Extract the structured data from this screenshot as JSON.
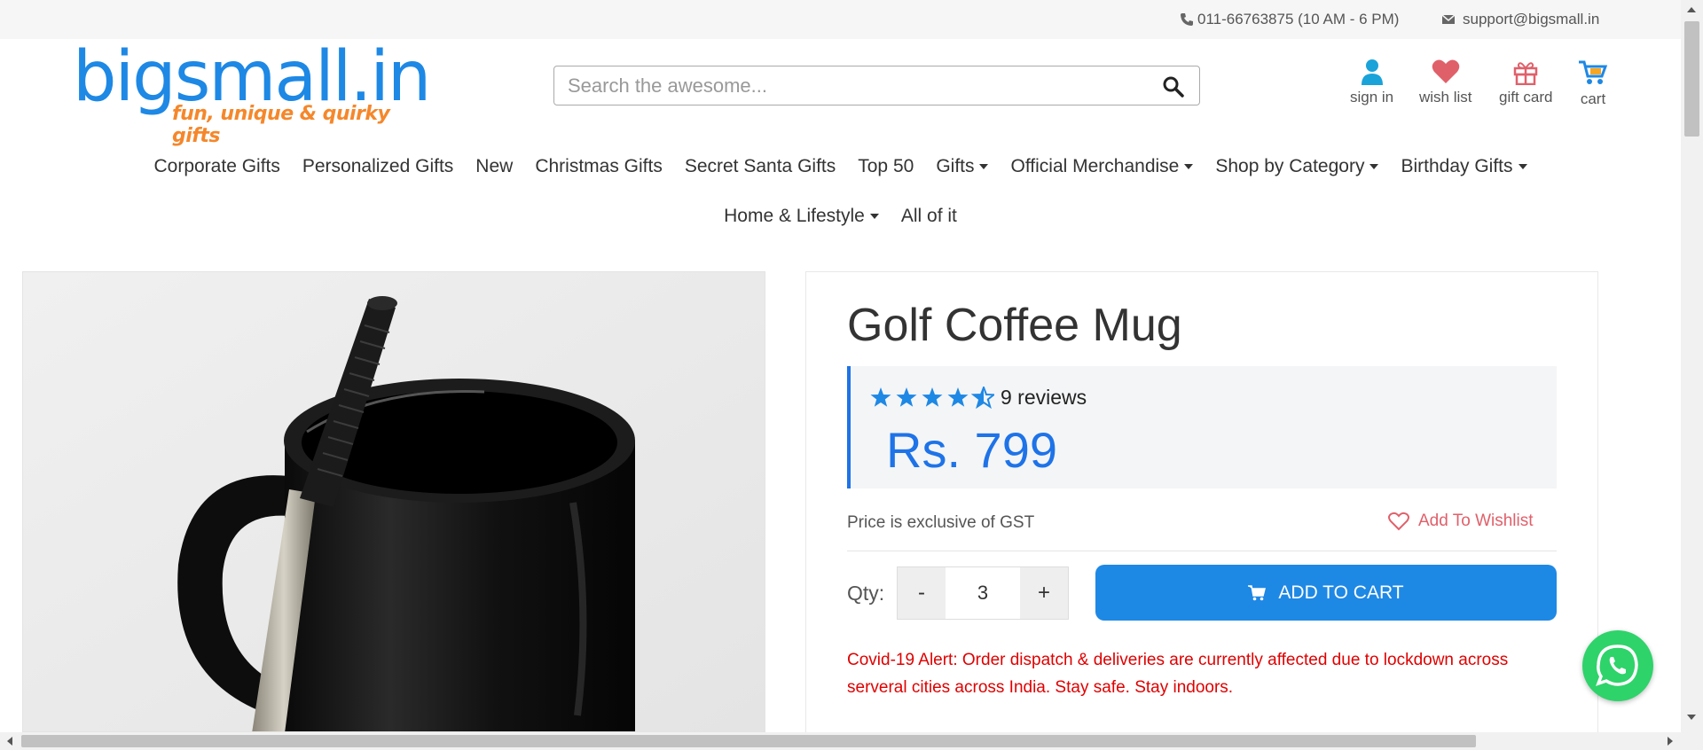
{
  "topbar": {
    "phone": "011-66763875 (10 AM - 6 PM)",
    "email": "support@bigsmall.in"
  },
  "logo": {
    "name": "bigsmall.in",
    "tagline": "fun, unique & quirky gifts"
  },
  "search": {
    "placeholder": "Search the awesome..."
  },
  "header_links": [
    {
      "label": "sign in",
      "icon": "user-icon",
      "color": "#1aa3d9"
    },
    {
      "label": "wish list",
      "icon": "heart-icon",
      "color": "#e0606a"
    },
    {
      "label": "gift card",
      "icon": "gift-icon",
      "color": "#e0606a"
    },
    {
      "label": "cart",
      "icon": "cart-icon",
      "color": "#1e88e5"
    }
  ],
  "nav": {
    "row1": [
      {
        "label": "Corporate Gifts",
        "dropdown": false
      },
      {
        "label": "Personalized Gifts",
        "dropdown": false
      },
      {
        "label": "New",
        "dropdown": false
      },
      {
        "label": "Christmas Gifts",
        "dropdown": false
      },
      {
        "label": "Secret Santa Gifts",
        "dropdown": false
      },
      {
        "label": "Top 50",
        "dropdown": false
      },
      {
        "label": "Gifts",
        "dropdown": true
      },
      {
        "label": "Official Merchandise",
        "dropdown": true
      },
      {
        "label": "Shop by Category",
        "dropdown": true
      },
      {
        "label": "Birthday Gifts",
        "dropdown": true
      }
    ],
    "row2": [
      {
        "label": "Home & Lifestyle",
        "dropdown": true
      },
      {
        "label": "All of it",
        "dropdown": false
      }
    ]
  },
  "product": {
    "title": "Golf Coffee Mug",
    "rating": 4.5,
    "reviews": "9 reviews",
    "price": "Rs. 799",
    "gst_note": "Price is exclusive of GST",
    "wishlist_label": "Add To Wishlist",
    "qty_label": "Qty:",
    "qty_minus": "-",
    "qty_plus": "+",
    "qty_value": "3",
    "cart_label": "ADD TO CART",
    "covid_alert": "Covid-19 Alert: Order dispatch & deliveries are currently affected due to lockdown across serveral cities across India. Stay safe. Stay indoors."
  },
  "colors": {
    "accent": "#1e88e5",
    "price": "#1e73e8",
    "alert": "#e00000",
    "wishlist": "#e0606a",
    "whatsapp": "#2ed36a",
    "logo_blue": "#1e88e5",
    "logo_orange": "#f5872b"
  }
}
